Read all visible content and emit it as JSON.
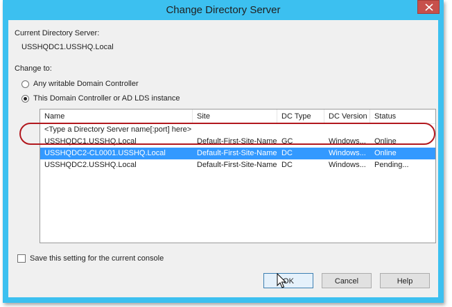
{
  "window": {
    "title": "Change Directory Server",
    "close_icon": "close-icon"
  },
  "current": {
    "label": "Current Directory Server:",
    "value": "USSHQDC1.USSHQ.Local"
  },
  "change_to": {
    "label": "Change to:",
    "options": [
      {
        "label": "Any writable Domain Controller",
        "checked": false
      },
      {
        "label": "This Domain Controller or AD LDS instance",
        "checked": true
      }
    ]
  },
  "table": {
    "columns": [
      "Name",
      "Site",
      "DC Type",
      "DC Version",
      "Status"
    ],
    "placeholder_row": "<Type a Directory Server name[:port] here>",
    "rows": [
      {
        "name": "USSHQDC1.USSHQ.Local",
        "site": "Default-First-Site-Name",
        "dc_type": "GC",
        "dc_version": "Windows...",
        "status": "Online",
        "selected": false
      },
      {
        "name": "USSHQDC2-CL0001.USSHQ.Local",
        "site": "Default-First-Site-Name",
        "dc_type": "DC",
        "dc_version": "Windows...",
        "status": "Online",
        "selected": true
      },
      {
        "name": "USSHQDC2.USSHQ.Local",
        "site": "Default-First-Site-Name",
        "dc_type": "DC",
        "dc_version": "Windows...",
        "status": "Pending...",
        "selected": false
      }
    ]
  },
  "save_setting": {
    "label": "Save this setting for the current console",
    "checked": false
  },
  "buttons": {
    "ok": "OK",
    "cancel": "Cancel",
    "help": "Help"
  },
  "colors": {
    "selection": "#3399ff",
    "highlight_ring": "#b1171d",
    "title_bar": "#3cc0f0",
    "close_button": "#c7504b"
  }
}
